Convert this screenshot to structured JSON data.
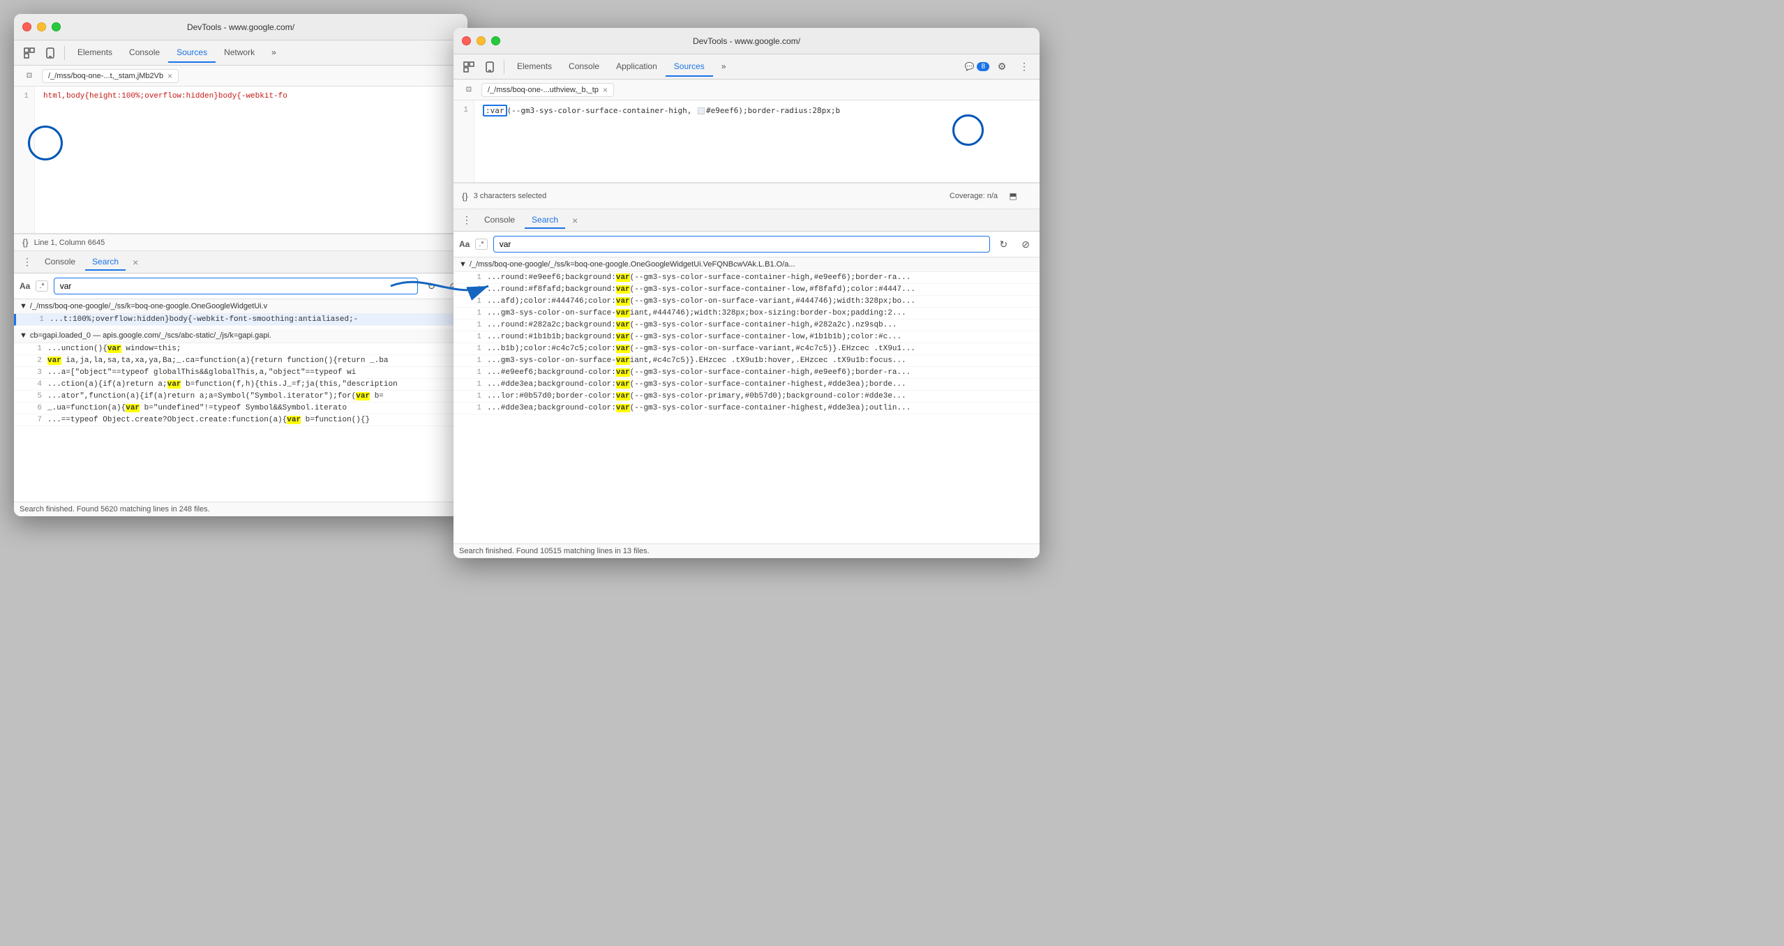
{
  "left_window": {
    "title": "DevTools - www.google.com/",
    "tabs": [
      "Elements",
      "Console",
      "Sources",
      "Network",
      "»"
    ],
    "active_tab": "Sources",
    "file_tab": "/_/mss/boq-one-...t,_stam,jMb2Vb",
    "code_line": 1,
    "code_text": "html,body{height:100%;overflow:hidden}body{-webkit-fo",
    "status_text": "Line 1, Column 6645",
    "panel_tabs": [
      "Console",
      "Search"
    ],
    "active_panel_tab": "Search",
    "search_input_value": "var",
    "search_aa": "Aa",
    "search_regex": ".*",
    "result_file1": "▼ /_/mss/boq-one-google/_/ss/k=boq-one-google.OneGoogleWidgetUi.v",
    "results_left": [
      {
        "line": "1",
        "text": "...t:100%;overflow:hidden}body{-webkit-font-smoothing:antialiased;-",
        "selected": true
      },
      {
        "line": "",
        "text": "",
        "selected": false
      }
    ],
    "result_file2": "▼ cb=gapi.loaded_0  —  apis.google.com/_/scs/abc-static/_/js/k=gapi.gapi.",
    "results2": [
      {
        "line": "1",
        "text": "...unction(){var window=this;"
      },
      {
        "line": "2",
        "text": "var ia,ja,la,sa,ta,xa,ya,Ba;_.ca=function(a){return function(){return _.ba"
      },
      {
        "line": "3",
        "text": "...a=[\"object\"==typeof globalThis&&globalThis,a,\"object\"==typeof wi"
      },
      {
        "line": "4",
        "text": "...ction(a){if(a)return a;var b=function(f,h){this.J_=f;ja(this,\"description"
      },
      {
        "line": "5",
        "text": "...ator\",function(a){if(a)return a;a=Symbol(\"Symbol.iterator\");for(var b="
      },
      {
        "line": "6",
        "text": "_.ua=function(a){var b=\"undefined\"!=typeof Symbol&&Symbol.iterato"
      },
      {
        "line": "7",
        "text": "...==typeof Object.create?Object.create:function(a){var b=function(){}"
      }
    ],
    "search_footer": "Search finished.  Found 5620 matching lines in 248 files."
  },
  "right_window": {
    "title": "DevTools - www.google.com/",
    "tabs": [
      "Elements",
      "Console",
      "Application",
      "Sources",
      "»"
    ],
    "active_tab": "Sources",
    "badge_count": "8",
    "file_tab": "/_/mss/boq-one-...uthview,_b,_tp",
    "code_line": 1,
    "code_text": ":var(--gm3-sys-color-surface-container-high,  #e9eef6);border-radius:28px;b",
    "code_selected": "var",
    "status_left": "3 characters selected",
    "coverage_label": "Coverage: n/a",
    "panel_tabs": [
      "Console",
      "Search"
    ],
    "active_panel_tab": "Search",
    "search_input_value": "var",
    "search_aa": "Aa",
    "search_regex": ".*",
    "result_file1": "▼ /_/mss/boq-one-google/_/ss/k=boq-one-google.OneGoogleWidgetUi.VeFQNBcwVAk.L.B1.O/a...",
    "results_right": [
      {
        "line": "1",
        "text": "...round:#e9eef6;background:var(--gm3-sys-color-surface-container-high,#e9eef6);border-ra..."
      },
      {
        "line": "1",
        "text": "...round:#f8fafd;background:var(--gm3-sys-color-surface-container-low,#f8fafd);color:#4447..."
      },
      {
        "line": "1",
        "text": "...afd);color:#444746;color:var(--gm3-sys-color-on-surface-variant,#444746);width:328px;bo..."
      },
      {
        "line": "1",
        "text": "...gm3-sys-color-on-surface-variant,#444746);width:328px;box-sizing:border-box;padding:2..."
      },
      {
        "line": "1",
        "text": "...round:#282a2c;background:var(--gm3-sys-color-surface-container-high,#282a2c).nz9sqb..."
      },
      {
        "line": "1",
        "text": "...round:#1b1b1b;background:var(--gm3-sys-color-surface-container-low,#1b1b1b);color:#c..."
      },
      {
        "line": "1",
        "text": "...b1b);color:#c4c7c5;color:var(--gm3-sys-color-on-surface-variant,#c4c7c5)}.EHzcec .tX9u1..."
      },
      {
        "line": "1",
        "text": "...gm3-sys-color-on-surface-variant,#c4c7c5)}.EHzcec .tX9u1b:hover,.EHzcec .tX9u1b:focus..."
      },
      {
        "line": "1",
        "text": "...#e9eef6;background-color:var(--gm3-sys-color-surface-container-high,#e9eef6);border-ra..."
      },
      {
        "line": "1",
        "text": "...#dde3ea;background-color:var(--gm3-sys-color-surface-container-highest,#dde3ea);borde..."
      },
      {
        "line": "1",
        "text": "...lor:#0b57d0;border-color:var(--gm3-sys-color-primary,#0b57d0);background-color:#dde3e..."
      },
      {
        "line": "1",
        "text": "...#dde3ea;background-color:var(--gm3-sys-color-surface-container-highest,#dde3ea);outlin..."
      }
    ],
    "search_footer": "Search finished.  Found 10515 matching lines in 13 files."
  }
}
